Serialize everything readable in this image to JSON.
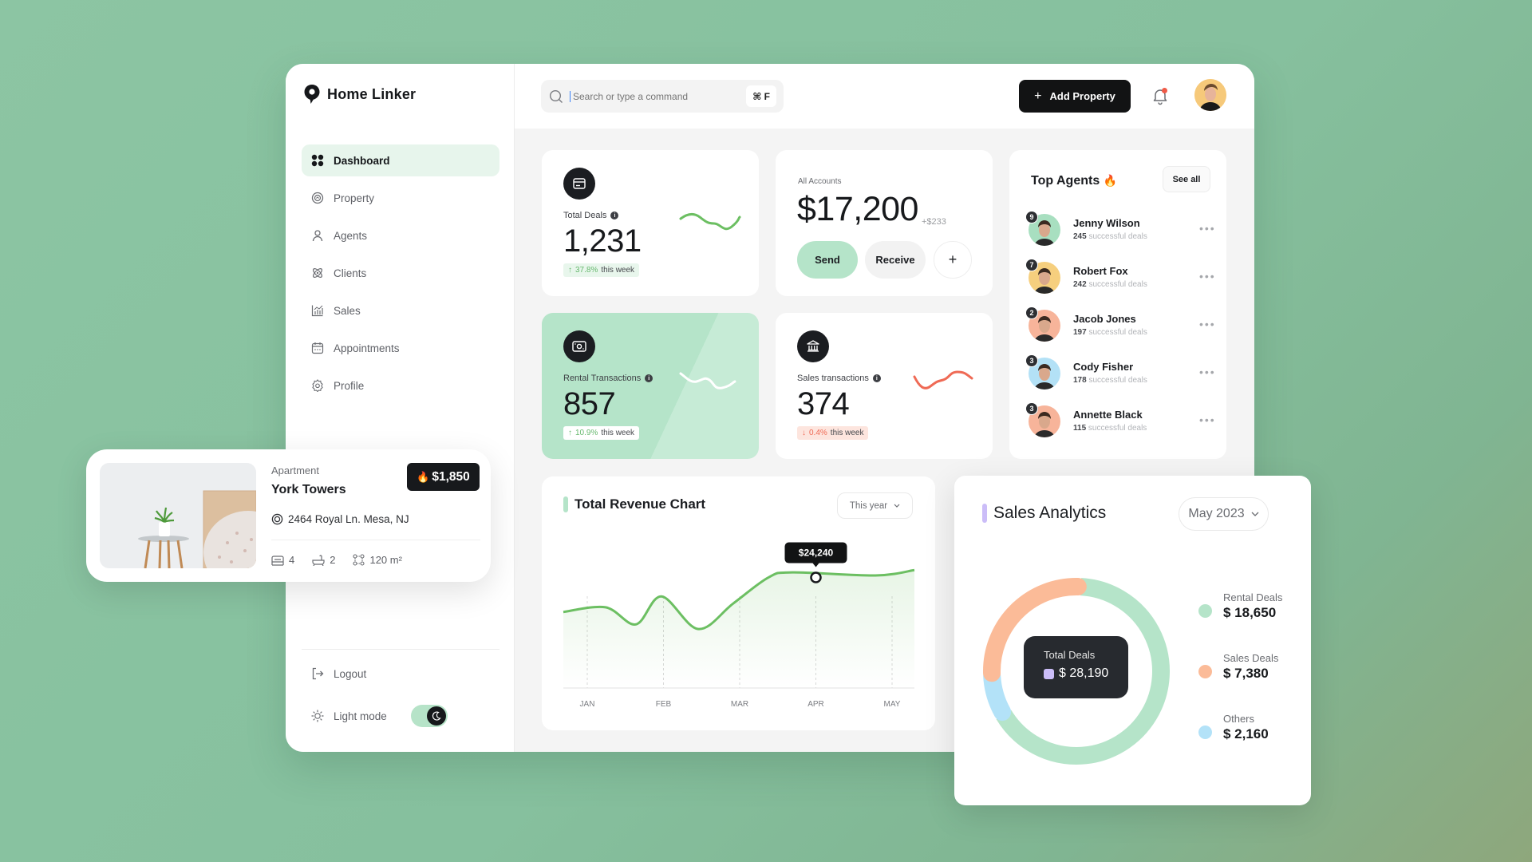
{
  "app": {
    "name": "Home Linker"
  },
  "sidebar": {
    "items": [
      {
        "label": "Dashboard",
        "icon": "grid-icon",
        "active": true
      },
      {
        "label": "Property",
        "icon": "home-pin-icon",
        "active": false
      },
      {
        "label": "Agents",
        "icon": "user-icon",
        "active": false
      },
      {
        "label": "Clients",
        "icon": "clients-icon",
        "active": false
      },
      {
        "label": "Sales",
        "icon": "chart-icon",
        "active": false
      },
      {
        "label": "Appointments",
        "icon": "calendar-icon",
        "active": false
      },
      {
        "label": "Profile",
        "icon": "gear-icon",
        "active": false
      }
    ],
    "logout_label": "Logout",
    "light_mode_label": "Light mode",
    "dark_mode_on": true
  },
  "topbar": {
    "search_placeholder": "Search or type a command",
    "search_shortcut": "⌘ F",
    "add_property_label": "Add Property",
    "has_notification": true
  },
  "stats": {
    "total_deals": {
      "label": "Total Deals",
      "value": "1,231",
      "change": "37.8%",
      "direction": "up",
      "suffix": "this week"
    },
    "rental": {
      "label": "Rental Transactions",
      "value": "857",
      "change": "10.9%",
      "direction": "up",
      "suffix": "this week"
    },
    "sales": {
      "label": "Sales transactions",
      "value": "374",
      "change": "0.4%",
      "direction": "down",
      "suffix": "this week"
    }
  },
  "accounts": {
    "label": "All Accounts",
    "value": "$17,200",
    "delta": "+$233",
    "send_label": "Send",
    "receive_label": "Receive",
    "add_label": "+"
  },
  "agents": {
    "title": "Top Agents",
    "title_emoji": "🔥",
    "see_all_label": "See all",
    "suffix": "successful deals",
    "list": [
      {
        "name": "Jenny Wilson",
        "deals": "245",
        "rank": "9",
        "bg": "#a8dfc0"
      },
      {
        "name": "Robert Fox",
        "deals": "242",
        "rank": "7",
        "bg": "#f6cf7e"
      },
      {
        "name": "Jacob Jones",
        "deals": "197",
        "rank": "2",
        "bg": "#f7b49a"
      },
      {
        "name": "Cody Fisher",
        "deals": "178",
        "rank": "3",
        "bg": "#b3e1f6"
      },
      {
        "name": "Annette Black",
        "deals": "115",
        "rank": "3",
        "bg": "#f7b49a"
      }
    ]
  },
  "property": {
    "type": "Apartment",
    "name": "York Towers",
    "price": "$1,850",
    "address": "2464 Royal Ln. Mesa, NJ",
    "beds": "4",
    "baths": "2",
    "area": "120 m²"
  },
  "revenue": {
    "title": "Total Revenue Chart",
    "period": "This year",
    "tooltip": "$24,240"
  },
  "sales_analytics": {
    "title": "Sales Analytics",
    "period": "May 2023",
    "total_label": "Total Deals",
    "total_value": "$ 28,190"
  },
  "colors": {
    "accent_green": "#b5e4c9",
    "line_green": "#6cbf62",
    "down_red": "#ef6a55",
    "sales_orange": "#fbbb98",
    "others_blue": "#b3e2f8",
    "purple": "#cbbdf8"
  },
  "chart_data": [
    {
      "type": "line",
      "title": "Total Revenue Chart",
      "categories": [
        "JAN",
        "FEB",
        "MAR",
        "APR",
        "MAY"
      ],
      "x": [
        0.0,
        0.5,
        1.0,
        1.5,
        2.0,
        2.5,
        3.0,
        3.25,
        4.0,
        4.25
      ],
      "series": [
        {
          "name": "Revenue",
          "values": [
            19800,
            20400,
            18200,
            21800,
            17600,
            20900,
            24240,
            24900,
            24500,
            25200
          ]
        }
      ],
      "highlight": {
        "category": "APR",
        "value": 24240,
        "label": "$24,240"
      },
      "ylim": [
        10000,
        28000
      ],
      "grid": "vertical-dashed",
      "xlabel": "",
      "ylabel": ""
    },
    {
      "type": "pie",
      "title": "Sales Analytics",
      "categories": [
        "Rental Deals",
        "Sales Deals",
        "Others"
      ],
      "values": [
        18650,
        7380,
        2160
      ],
      "value_labels": [
        "$ 18,650",
        "$ 7,380",
        "$ 2,160"
      ],
      "total": 28190,
      "legend": "right",
      "style": "donut"
    }
  ]
}
